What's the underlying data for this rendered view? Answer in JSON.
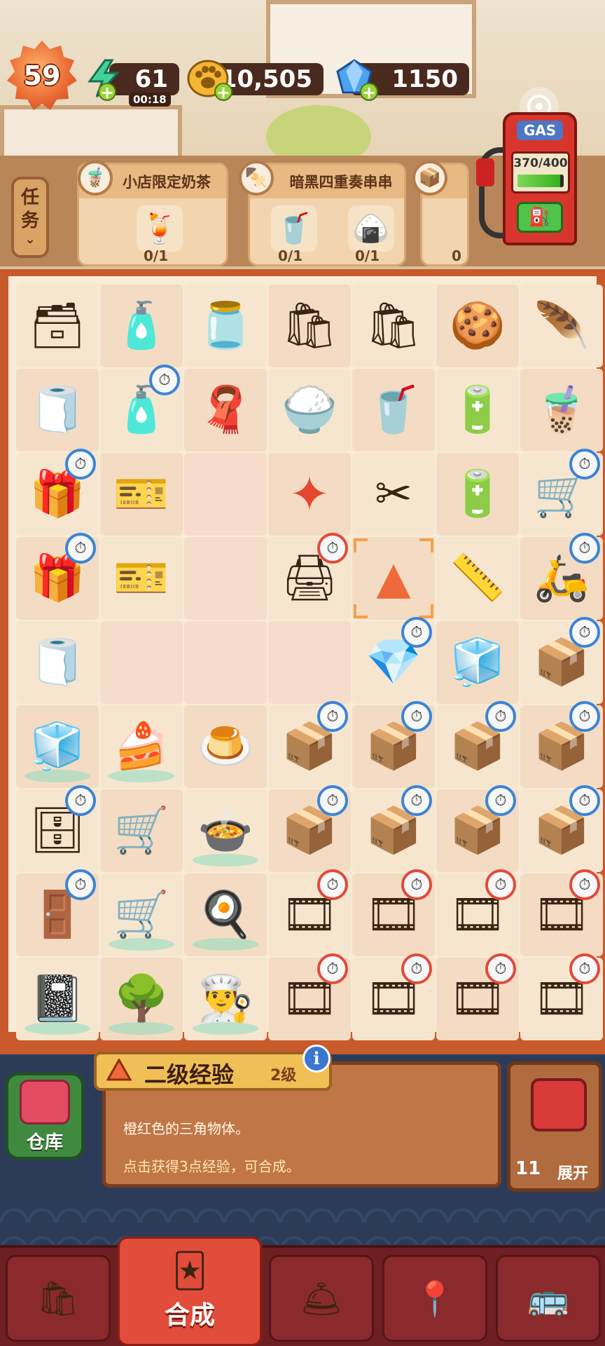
{
  "hud": {
    "level": "59",
    "energy": "61",
    "energy_timer": "00:18",
    "coins": "10,505",
    "gems": "1150",
    "gas_label": "GAS",
    "gas_reading": "370/400",
    "gas_fraction": 0.925
  },
  "tasks": {
    "tab_label_1": "任",
    "tab_label_2": "务",
    "orders": [
      {
        "title": "小店限定奶茶",
        "items": [
          {
            "icon": "milk-tea-icon",
            "progress": "0/1"
          }
        ]
      },
      {
        "title": "暗黑四重奏串串",
        "items": [
          {
            "icon": "orange-drink-icon",
            "progress": "0/1"
          },
          {
            "icon": "rice-ball-icon",
            "progress": "0/1"
          }
        ]
      },
      {
        "title": "",
        "items": [
          {
            "icon": "package-icon",
            "progress": "0"
          }
        ]
      }
    ]
  },
  "board": {
    "rows": [
      [
        "sample-box",
        "medicine-bottles",
        "ink-bottle",
        "paper-bag",
        "paper-bag",
        "cookie",
        "feather-fan"
      ],
      [
        "towel",
        "glue-bottle",
        "cloth",
        "rice-tray",
        "paper-cup",
        "power-chest",
        "bubble-tea"
      ],
      [
        "gift-box",
        "ticket",
        "",
        "star-shard",
        "scissors",
        "power-chest",
        "hand-truck"
      ],
      [
        "gift-box",
        "ticket",
        "",
        "printer",
        "triangle-shard",
        "tape-measure",
        "scooter"
      ],
      [
        "paper-ball",
        "",
        "",
        "",
        "crystal",
        "sugar-cubes",
        "drone-box"
      ],
      [
        "fridge-locked",
        "display-case",
        "pudding-tray",
        "drone-box",
        "drone-box",
        "drone-box",
        "drone-box"
      ],
      [
        "cabinet",
        "shelf-cart",
        "hotpot",
        "drone-box",
        "drone-box",
        "drone-box",
        "drone-box"
      ],
      [
        "fridge",
        "cart",
        "oven",
        "film-roll",
        "film-roll",
        "film-roll",
        "film-roll"
      ],
      [
        "notebook",
        "bonsai",
        "chef-hat",
        "film-roll",
        "film-roll",
        "film-roll",
        "film-roll"
      ]
    ]
  },
  "info": {
    "warehouse_label": "仓库",
    "item_name": "二级经验",
    "item_level": "2级",
    "info_button": "i",
    "description": "橙红色的三角物体。",
    "hint": "点击获得3点经验，可合成。",
    "chest_count": "11",
    "chest_expand": "展开"
  },
  "nav": {
    "merge_label": "合成"
  }
}
